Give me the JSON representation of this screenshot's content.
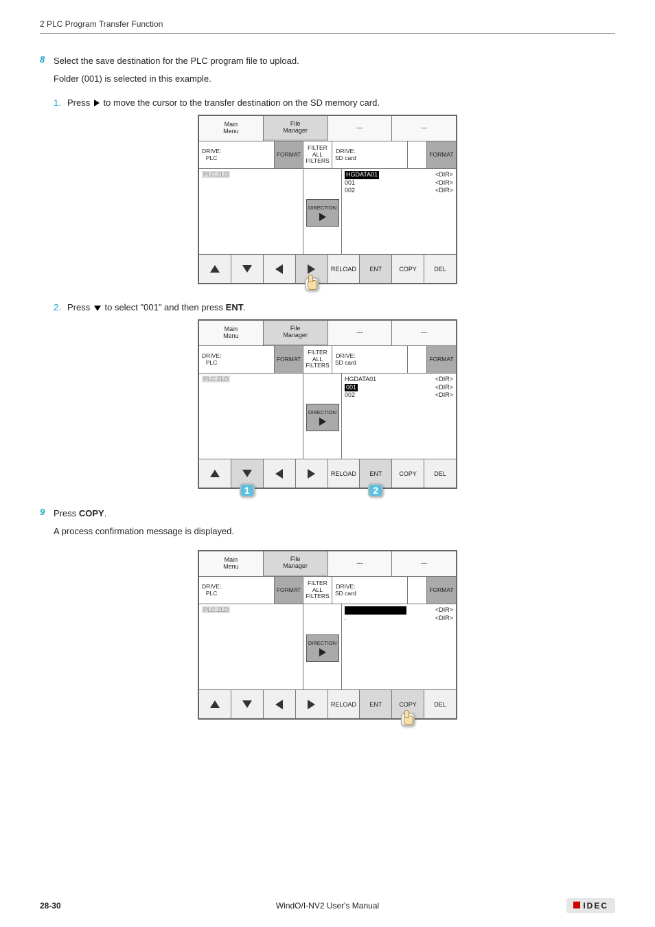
{
  "header": "2 PLC Program Transfer Function",
  "step8": {
    "num": "8",
    "line1": "Select the save destination for the PLC program file to upload.",
    "line2": "Folder (001) is selected in this example."
  },
  "sub1": {
    "num": "1.",
    "before": "Press",
    "after": "to move the cursor to the transfer destination on the SD memory card."
  },
  "sub2": {
    "num": "2.",
    "before": "Press",
    "mid": "to select \"001\" and then press",
    "bold": "ENT",
    "end": "."
  },
  "step9": {
    "num": "9",
    "line1p": "Press ",
    "line1b": "COPY",
    "line1e": ".",
    "line2": "A process confirmation message is displayed."
  },
  "dev": {
    "tabs": {
      "t1a": "Main",
      "t1b": "Menu",
      "t2a": "File",
      "t2b": "Manager",
      "t3": "---",
      "t4": "---"
    },
    "row2": {
      "driveL_a": "DRIVE:",
      "driveL_b": "PLC",
      "format": "FORMAT",
      "filter_a": "FILTER",
      "filter_b": "ALL",
      "filter_c": "FILTERS",
      "driveR_a": "DRIVE:",
      "driveR_b": "SD  card"
    },
    "left_file": "PLC.ZLD",
    "dir_label": "DIRECTION",
    "right_full": {
      "r0n": "HGDATA01",
      "r0t": "<DIR>",
      "r1n": "001",
      "r1t": "<DIR>",
      "r2n": "002",
      "r2t": "<DIR>"
    },
    "right_short": {
      "r0n": "",
      "r0t": "<DIR>",
      "r1n": ".",
      "r1t": "<DIR>"
    },
    "bot": {
      "reload": "RELOAD",
      "ent": "ENT",
      "copy": "COPY",
      "del": "DEL"
    }
  },
  "callouts": {
    "one": "1",
    "two": "2"
  },
  "footer": {
    "left": "28-30",
    "center": "WindO/I-NV2 User's Manual",
    "right": "IDEC"
  }
}
